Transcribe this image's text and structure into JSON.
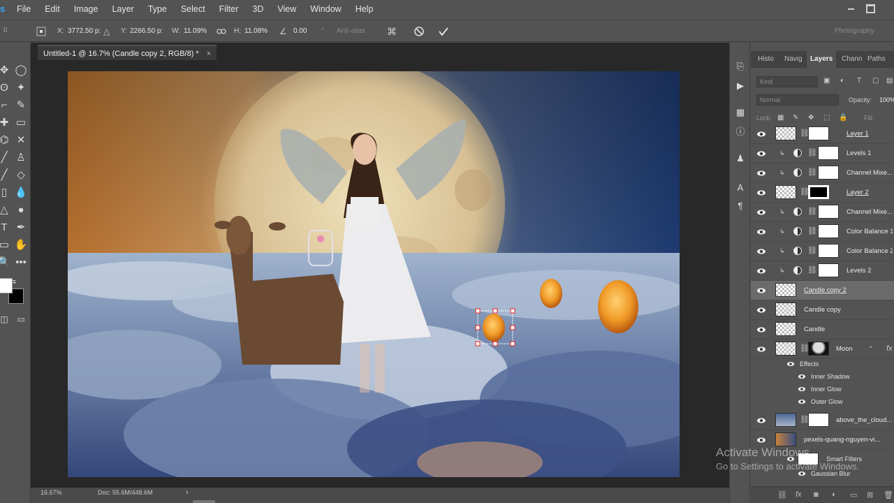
{
  "app": {
    "logo": "s",
    "menu": [
      "File",
      "Edit",
      "Image",
      "Layer",
      "Type",
      "Select",
      "Filter",
      "3D",
      "View",
      "Window",
      "Help"
    ]
  },
  "options_bar": {
    "x_label": "X:",
    "x_value": "3772.50 p:",
    "y_label": "Y:",
    "y_value": "2266.50 p:",
    "w_label": "W:",
    "w_value": "11.09%",
    "h_label": "H:",
    "h_value": "11.08%",
    "angle_value": "0.00",
    "degree": "°",
    "antialias": "Anti-alias",
    "workspace": "Photography"
  },
  "document": {
    "tab_title": "Untitled-1 @ 16.7% (Candle copy 2, RGB/8) *",
    "tab_close": "×"
  },
  "status": {
    "zoom": "16.67%",
    "doc_size": "Doc: 55.6M/448.6M",
    "arrow": "›"
  },
  "panel_tabs": {
    "history": "Histo",
    "navigator": "Navig",
    "layers": "Layers",
    "channels": "Chann",
    "paths": "Paths"
  },
  "layers_panel": {
    "filter_placeholder": "Kind",
    "blend_mode": "Normal",
    "opacity_label": "Opacity:",
    "opacity_value": "100%",
    "lock_label": "Lock:",
    "fill_label": "Fill:"
  },
  "layers": [
    {
      "name": "Layer 1",
      "kind": "pixel-mask",
      "selected": false
    },
    {
      "name": "Levels 1",
      "kind": "adjustment",
      "selected": false
    },
    {
      "name": "Channel Mixe...",
      "kind": "adjustment",
      "selected": false
    },
    {
      "name": "Layer 2",
      "kind": "pixel-mask",
      "selected": false
    },
    {
      "name": "Channel Mixe...",
      "kind": "adjustment",
      "selected": false
    },
    {
      "name": "Color Balance 1",
      "kind": "adjustment",
      "selected": false
    },
    {
      "name": "Color Balance 2",
      "kind": "adjustment",
      "selected": false
    },
    {
      "name": "Levels 2",
      "kind": "adjustment",
      "selected": false
    },
    {
      "name": "Candle copy 2",
      "kind": "pixel",
      "selected": true
    },
    {
      "name": "Candle copy",
      "kind": "pixel",
      "selected": false
    },
    {
      "name": "Candle",
      "kind": "pixel",
      "selected": false
    },
    {
      "name": "Moon",
      "kind": "pixel-mask-fx",
      "selected": false
    }
  ],
  "effects": {
    "label": "Effects",
    "items": [
      "Inner Shadow",
      "Inner Glow",
      "Outer Glow"
    ],
    "fx": "fx"
  },
  "bottom_layers": [
    {
      "name": "above_the_cloud..."
    },
    {
      "name": "pexels-quang-nguyen-vi..."
    }
  ],
  "smart_filters": {
    "label": "Smart Filters",
    "item": "Gaussian Blur"
  },
  "watermark": {
    "line1": "Activate Windows",
    "line2": "Go to Settings to activate Windows."
  },
  "colors": {
    "accent": "#31a8ff",
    "panel_bg": "#535353",
    "canvas_bg": "#282828"
  }
}
